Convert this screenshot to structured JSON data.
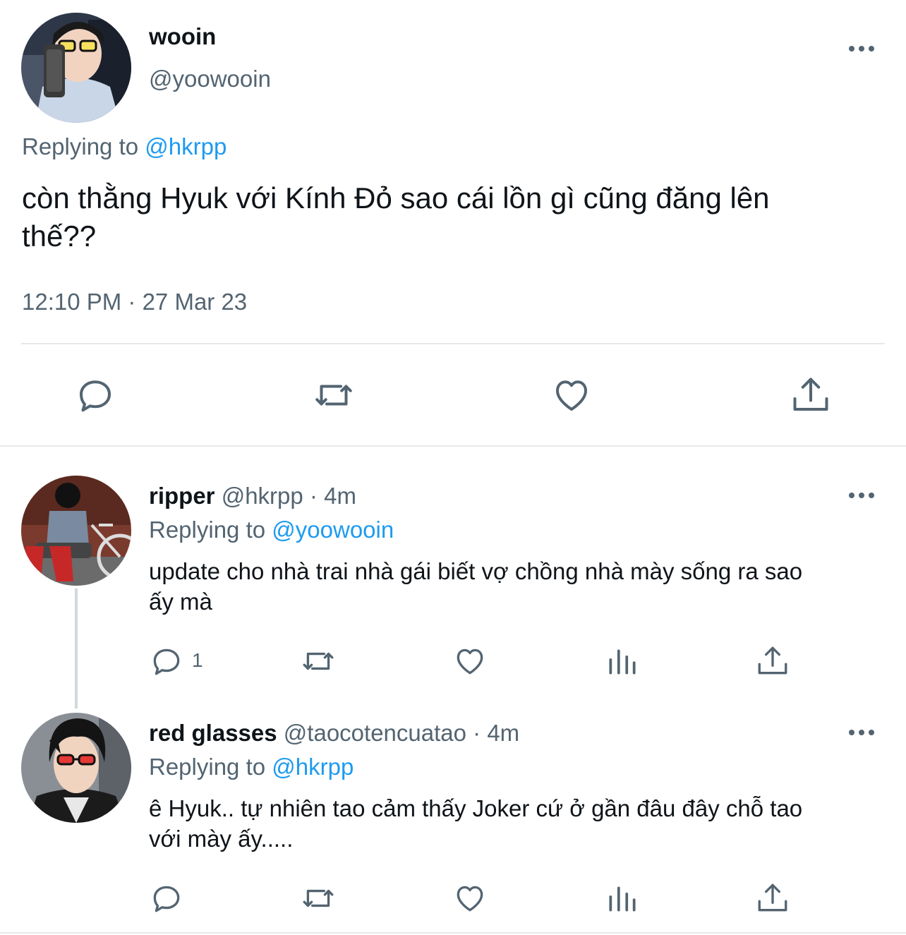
{
  "main_tweet": {
    "display_name": "wooin",
    "handle": "@yoowooin",
    "replying_prefix": "Replying to",
    "replying_handle": "@hkrpp",
    "text_line1": "còn thằng Hyuk với Kính Đỏ sao cái lồn gì cũng đăng lên",
    "text_line2": "thế??",
    "timestamp": "12:10 PM · 27 Mar 23"
  },
  "replies": [
    {
      "display_name": "ripper",
      "handle": "@hkrpp",
      "sep": "·",
      "time": "4m",
      "replying_prefix": "Replying to",
      "replying_handle": "@yoowooin",
      "text_line1": "update cho nhà trai nhà gái biết vợ chồng nhà mày sống ra sao",
      "text_line2": "ấy mà",
      "reply_count": "1"
    },
    {
      "display_name": "red glasses",
      "handle": "@taocotencuatao",
      "sep": "·",
      "time": "4m",
      "replying_prefix": "Replying to",
      "replying_handle": "@hkrpp",
      "text_line1": "ê Hyuk.. tự nhiên tao cảm thấy Joker cứ ở gần đâu đây chỗ tao",
      "text_line2": "với mày ấy.....",
      "reply_count": ""
    }
  ],
  "icons": {
    "reply": "reply-icon",
    "retweet": "retweet-icon",
    "like": "heart-icon",
    "views": "views-icon",
    "share": "share-icon",
    "more": "more-icon"
  },
  "colors": {
    "link": "#1d9bf0",
    "secondary_text": "#536471",
    "divider": "#e6e9eb"
  }
}
